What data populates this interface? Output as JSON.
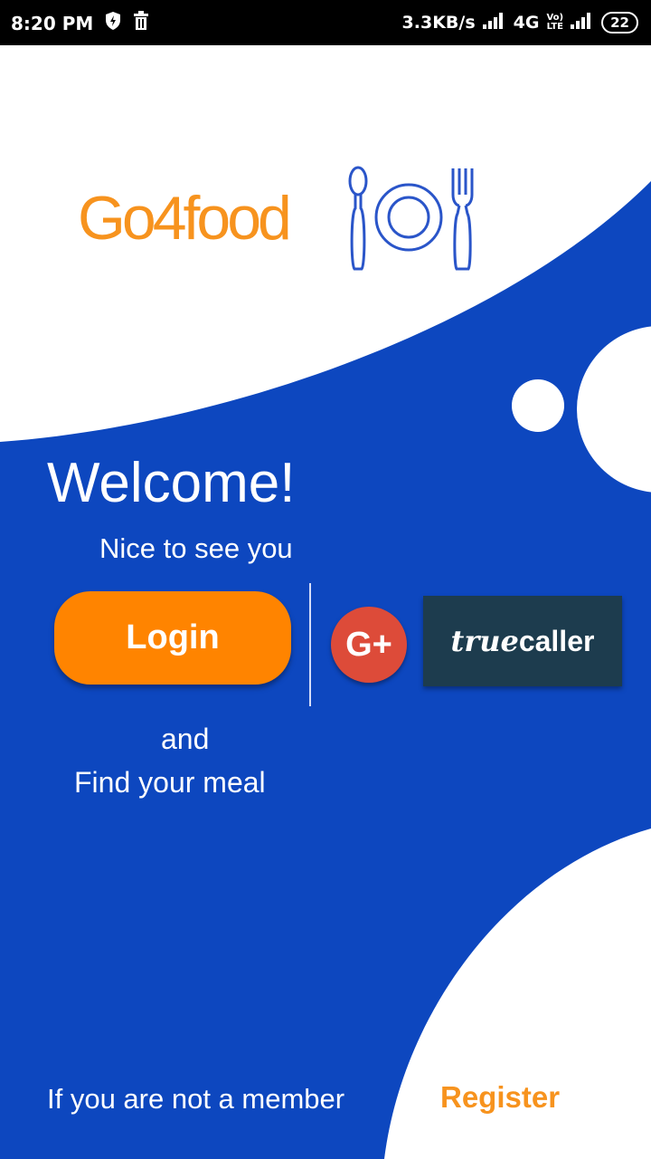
{
  "status_bar": {
    "time": "8:20 PM",
    "net_speed": "3.3KB/s",
    "network": "4G",
    "volte_top": "Vo)",
    "volte_bottom": "LTE",
    "battery": "22"
  },
  "logo": {
    "text": "Go4food"
  },
  "main": {
    "welcome": "Welcome!",
    "subtitle": "Nice to see you",
    "login_label": "Login",
    "google_label": "G+",
    "truecaller_true": "true",
    "truecaller_caller": "caller",
    "and_text": "and",
    "find_text": "Find your meal"
  },
  "footer": {
    "member_text": "If you are not a member",
    "register_label": "Register"
  },
  "colors": {
    "brand_blue": "#0d47bf",
    "brand_orange": "#ff8400",
    "google_red": "#dd4b39",
    "truecaller_bg": "#1d3c4e"
  }
}
